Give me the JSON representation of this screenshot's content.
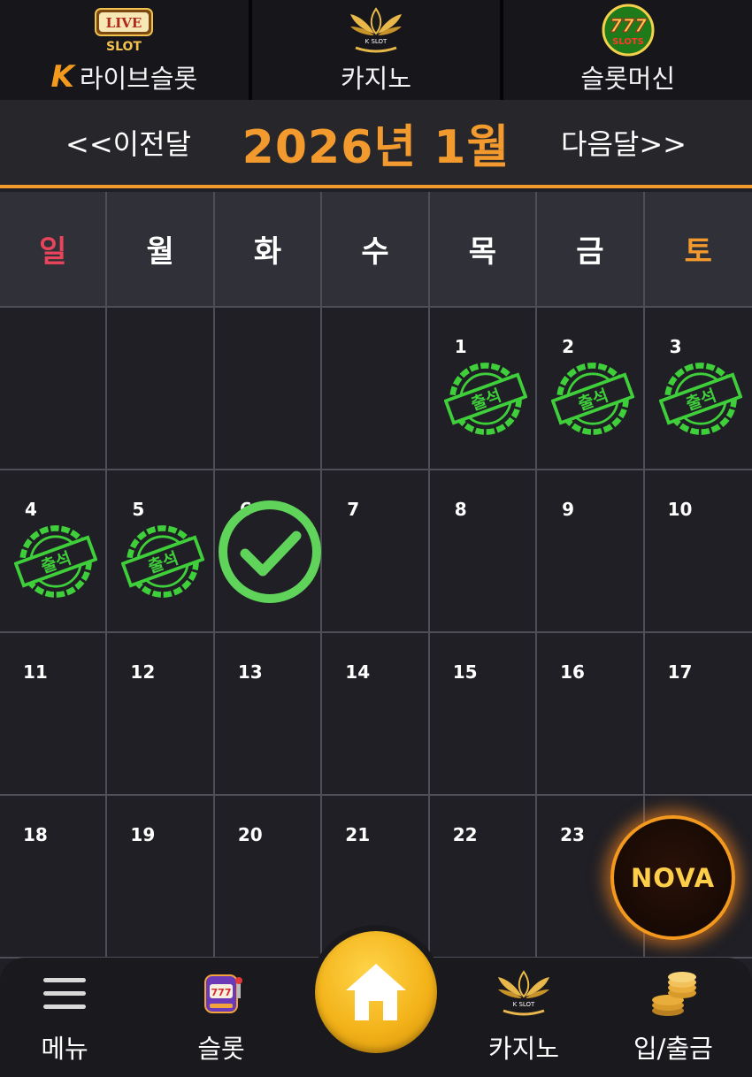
{
  "topnav": {
    "tabs": [
      {
        "label": "라이브슬롯",
        "logo_text_top": "LIVE",
        "logo_text_bottom": "SLOT",
        "mark": "K"
      },
      {
        "label": "카지노",
        "logo_text": "K SLOT"
      },
      {
        "label": "슬롯머신",
        "logo_text_top": "777",
        "logo_text_bottom": "SLOTS"
      }
    ]
  },
  "month": {
    "prev_label": "<<이전달",
    "title": "2026년 1월",
    "next_label": "다음달>>"
  },
  "calendar": {
    "weekdays": [
      "일",
      "월",
      "화",
      "수",
      "목",
      "금",
      "토"
    ],
    "days": [
      {
        "num": "",
        "state": "empty"
      },
      {
        "num": "",
        "state": "empty"
      },
      {
        "num": "",
        "state": "empty"
      },
      {
        "num": "",
        "state": "empty"
      },
      {
        "num": "1",
        "state": "attended"
      },
      {
        "num": "2",
        "state": "attended"
      },
      {
        "num": "3",
        "state": "attended"
      },
      {
        "num": "4",
        "state": "attended"
      },
      {
        "num": "5",
        "state": "attended"
      },
      {
        "num": "6",
        "state": "today"
      },
      {
        "num": "7",
        "state": "none"
      },
      {
        "num": "8",
        "state": "none"
      },
      {
        "num": "9",
        "state": "none"
      },
      {
        "num": "10",
        "state": "none"
      },
      {
        "num": "11",
        "state": "none"
      },
      {
        "num": "12",
        "state": "none"
      },
      {
        "num": "13",
        "state": "none"
      },
      {
        "num": "14",
        "state": "none"
      },
      {
        "num": "15",
        "state": "none"
      },
      {
        "num": "16",
        "state": "none"
      },
      {
        "num": "17",
        "state": "none"
      },
      {
        "num": "18",
        "state": "none"
      },
      {
        "num": "19",
        "state": "none"
      },
      {
        "num": "20",
        "state": "none"
      },
      {
        "num": "21",
        "state": "none"
      },
      {
        "num": "22",
        "state": "none"
      },
      {
        "num": "23",
        "state": "none"
      },
      {
        "num": "",
        "state": "covered"
      }
    ],
    "stamp_text": "출석"
  },
  "floating": {
    "nova_text": "NOVA"
  },
  "bottombar": {
    "menu": "메뉴",
    "slot": "슬롯",
    "casino": "카지노",
    "casino_logo_text": "K SLOT",
    "bank": "입/출금"
  },
  "colors": {
    "accent": "#f29a2e",
    "sunday": "#e9455a",
    "stamp_green": "#3fcf3a",
    "check_green": "#5fd35a",
    "home_gold": "#f3b31a"
  },
  "icons": [
    "k-logo-icon",
    "live-slot-logo-icon",
    "k-slot-lotus-icon",
    "777-slots-icon",
    "attendance-stamp-icon",
    "check-circle-icon",
    "nova-icon",
    "menu-icon",
    "slot-machine-icon",
    "home-icon",
    "coins-icon"
  ]
}
